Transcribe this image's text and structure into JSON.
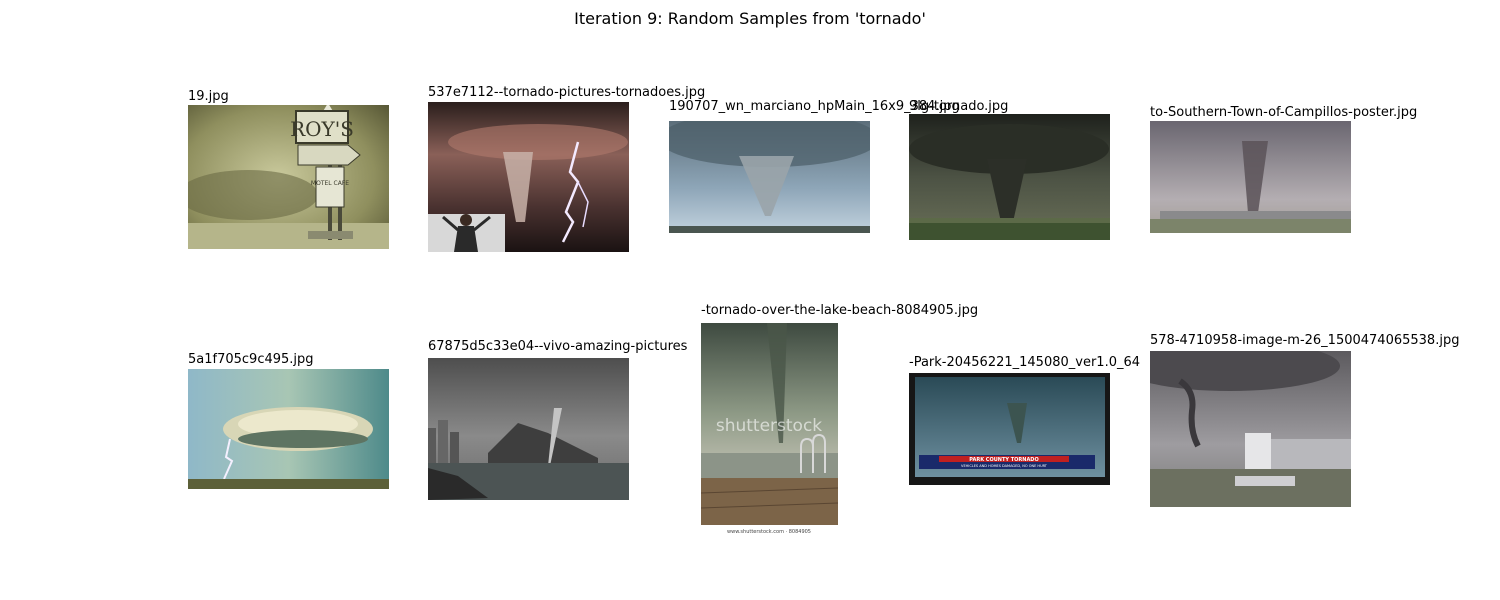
{
  "figure": {
    "title": "Iteration 9: Random Samples from 'tornado'"
  },
  "samples": [
    {
      "filename": "19.jpg",
      "sign_text": "ROY'S",
      "sign_sub": "MOTEL CAFE"
    },
    {
      "filename": "537e7112--tornado-pictures-tornadoes.jpg"
    },
    {
      "filename": "190707_wn_marciano_hpMain_16x9_384.jpg"
    },
    {
      "filename": "9lg-tornado.jpg"
    },
    {
      "filename": "to-Southern-Town-of-Campillos-poster.jpg"
    },
    {
      "filename": "5a1f705c9c495.jpg"
    },
    {
      "filename": "67875d5c33e04--vivo-amazing-pictures"
    },
    {
      "filename": "-tornado-over-the-lake-beach-8084905.jpg",
      "watermark": "shutterstock",
      "footer": "www.shutterstock.com · 8084905"
    },
    {
      "filename": "-Park-20456221_145080_ver1.0_64",
      "banner_title": "PARK COUNTY TORNADO",
      "banner_sub": "VEHICLES AND HOMES DAMAGED, NO ONE HURT"
    },
    {
      "filename": "578-4710958-image-m-26_1500474065538.jpg"
    }
  ]
}
